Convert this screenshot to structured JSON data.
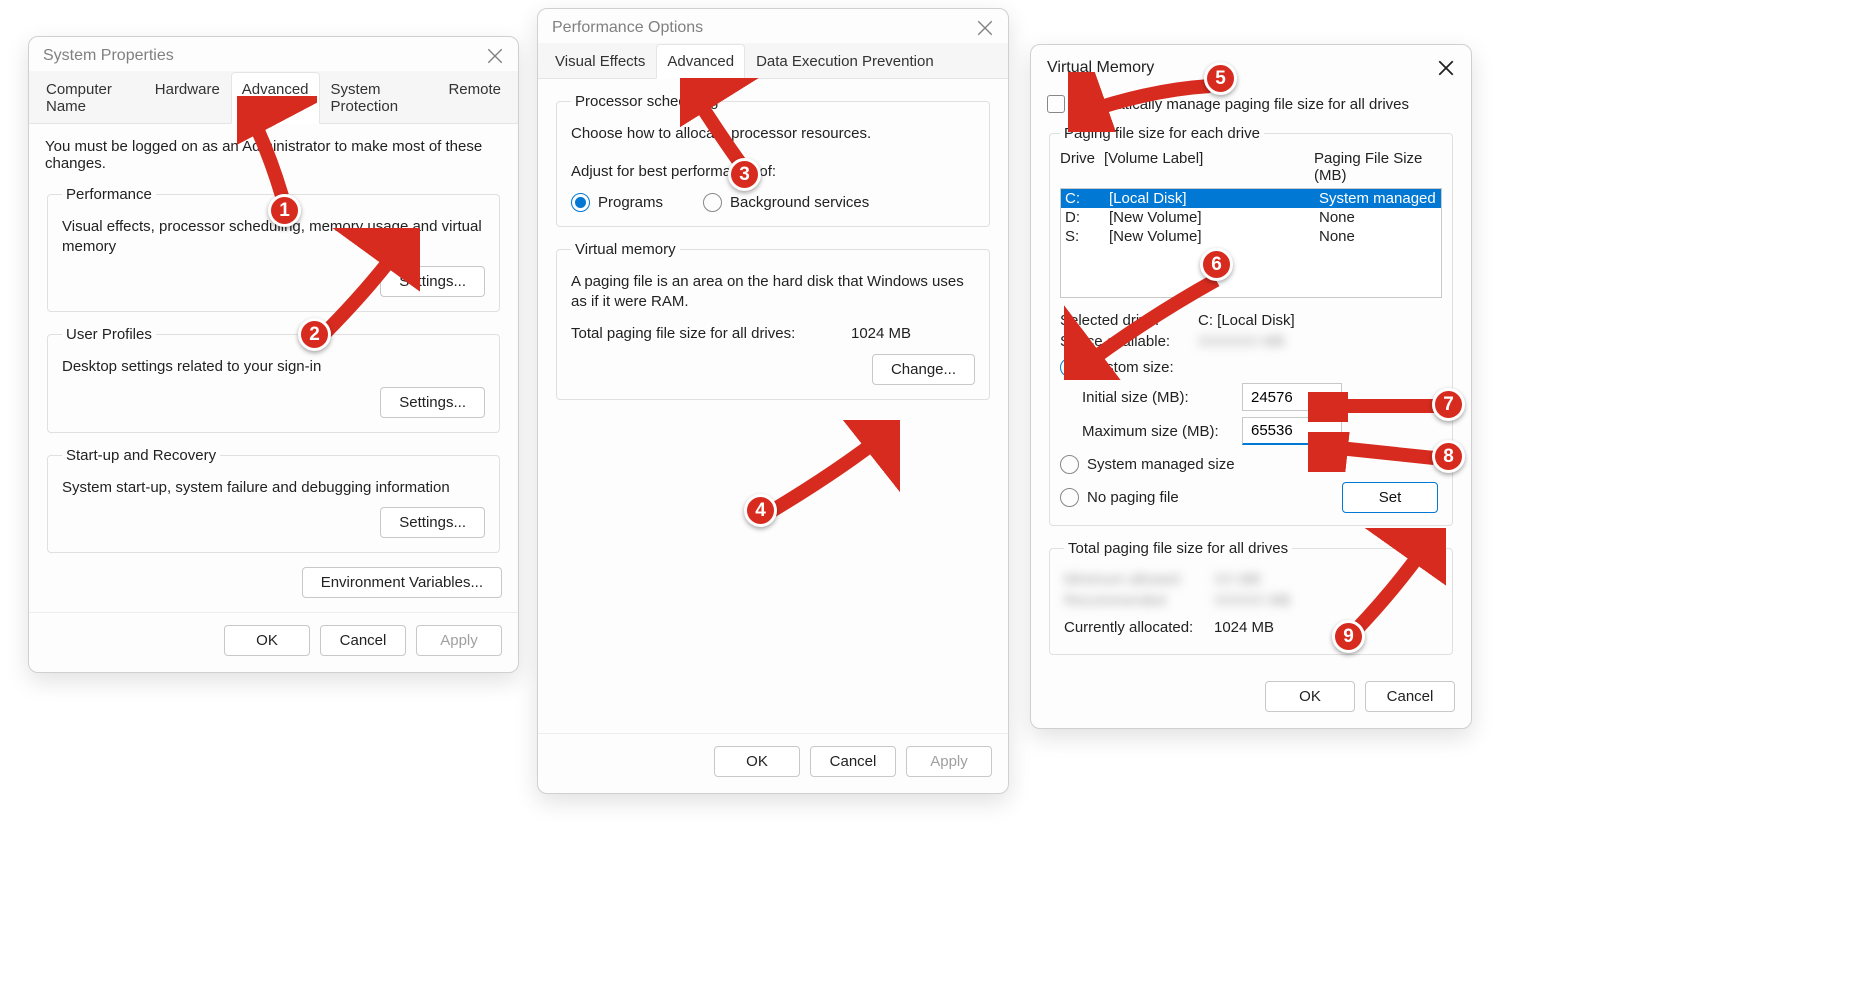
{
  "sysprops": {
    "title": "System Properties",
    "tabs": {
      "computer_name": "Computer Name",
      "hardware": "Hardware",
      "advanced": "Advanced",
      "system_protection": "System Protection",
      "remote": "Remote"
    },
    "admin_note": "You must be logged on as an Administrator to make most of these changes.",
    "performance": {
      "title": "Performance",
      "desc": "Visual effects, processor scheduling, memory usage and virtual memory",
      "settings_btn": "Settings..."
    },
    "user_profiles": {
      "title": "User Profiles",
      "desc": "Desktop settings related to your sign-in",
      "settings_btn": "Settings..."
    },
    "startup": {
      "title": "Start-up and Recovery",
      "desc": "System start-up, system failure and debugging information",
      "settings_btn": "Settings..."
    },
    "env_vars_btn": "Environment Variables...",
    "ok": "OK",
    "cancel": "Cancel",
    "apply": "Apply"
  },
  "perfopts": {
    "title": "Performance Options",
    "tabs": {
      "visual_effects": "Visual Effects",
      "advanced": "Advanced",
      "dep": "Data Execution Prevention"
    },
    "proc_sched": {
      "title": "Processor scheduling",
      "desc": "Choose how to allocate processor resources.",
      "adjust_label": "Adjust for best performance of:",
      "programs": "Programs",
      "background": "Background services"
    },
    "vmem": {
      "title": "Virtual memory",
      "desc": "A paging file is an area on the hard disk that Windows uses as if it were RAM.",
      "total_label": "Total paging file size for all drives:",
      "total_value": "1024 MB",
      "change_btn": "Change..."
    },
    "ok": "OK",
    "cancel": "Cancel",
    "apply": "Apply"
  },
  "vm": {
    "title": "Virtual Memory",
    "auto_manage": "Automatically manage paging file size for all drives",
    "per_drive_title": "Paging file size for each drive",
    "header_drive": "Drive",
    "header_label": "[Volume Label]",
    "header_size": "Paging File Size (MB)",
    "drives": [
      {
        "letter": "C:",
        "label": "[Local Disk]",
        "size": "System managed",
        "selected": true
      },
      {
        "letter": "D:",
        "label": "[New Volume]",
        "size": "None",
        "selected": false
      },
      {
        "letter": "S:",
        "label": "[New Volume]",
        "size": "None",
        "selected": false
      }
    ],
    "selected_drive_label": "Selected drive:",
    "selected_drive_value": "C:  [Local Disk]",
    "space_available_label": "Space available:",
    "custom_size": "Custom size:",
    "initial_label": "Initial size (MB):",
    "initial_value": "24576",
    "max_label": "Maximum size (MB):",
    "max_value": "65536",
    "system_managed": "System managed size",
    "no_paging": "No paging file",
    "set_btn": "Set",
    "total_group": "Total paging file size for all drives",
    "currently_allocated_label": "Currently allocated:",
    "currently_allocated_value": "1024 MB",
    "ok": "OK",
    "cancel": "Cancel"
  },
  "callouts": [
    "1",
    "2",
    "3",
    "4",
    "5",
    "6",
    "7",
    "8",
    "9"
  ]
}
